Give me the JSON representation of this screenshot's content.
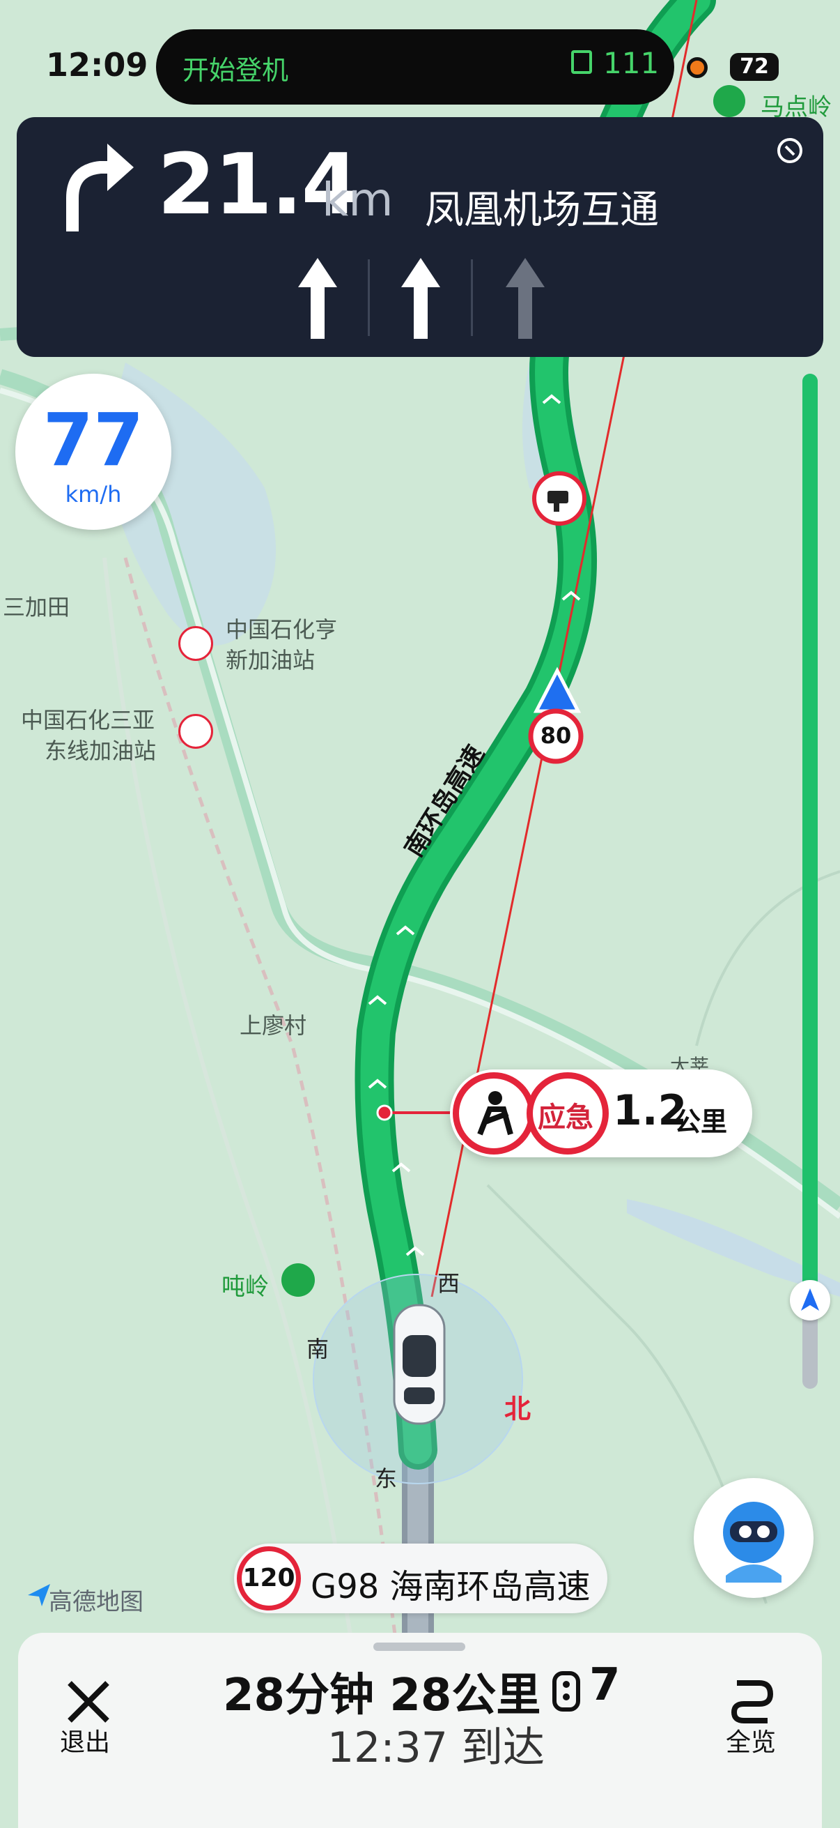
{
  "status_bar": {
    "time": "12:09",
    "boarding_text": "开始登机",
    "gate_value": "111",
    "battery": "72"
  },
  "nav": {
    "distance": "21.4",
    "distance_unit": "km",
    "road_name": "凤凰机场互通",
    "lanes": 3
  },
  "speed": {
    "value": "77",
    "unit": "km/h"
  },
  "route_progress_fraction": 0.9,
  "map_labels": {
    "top_mountain": "马点岭",
    "place_sanjiatian": "三加田",
    "gas1": "中国石化亨",
    "gas1b": "新加油站",
    "gas2": "中国石化三亚",
    "gas2b": "东线加油站",
    "village": "上廖村",
    "taiping": "太莘",
    "dunling": "吨岭",
    "highway_label": "南环岛高速",
    "speed_limit_map": "80",
    "compass_n": "北",
    "compass_s": "南",
    "compass_e": "东",
    "compass_w": "西"
  },
  "incident": {
    "label": "应急",
    "distance": "1.2",
    "unit": "公里"
  },
  "current_road": {
    "speed_limit": "120",
    "name": "G98 海南环岛高速"
  },
  "brand": "高德地图",
  "bottom": {
    "exit_label": "退出",
    "summary": "28分钟  28公里",
    "lights": "7",
    "arrival": "12:37 到达",
    "overview_label": "全览"
  },
  "colors": {
    "route_green": "#1fc06b",
    "nav_bg": "#1b2233",
    "speed_blue": "#1e6cf2",
    "alert_red": "#e4243a"
  }
}
